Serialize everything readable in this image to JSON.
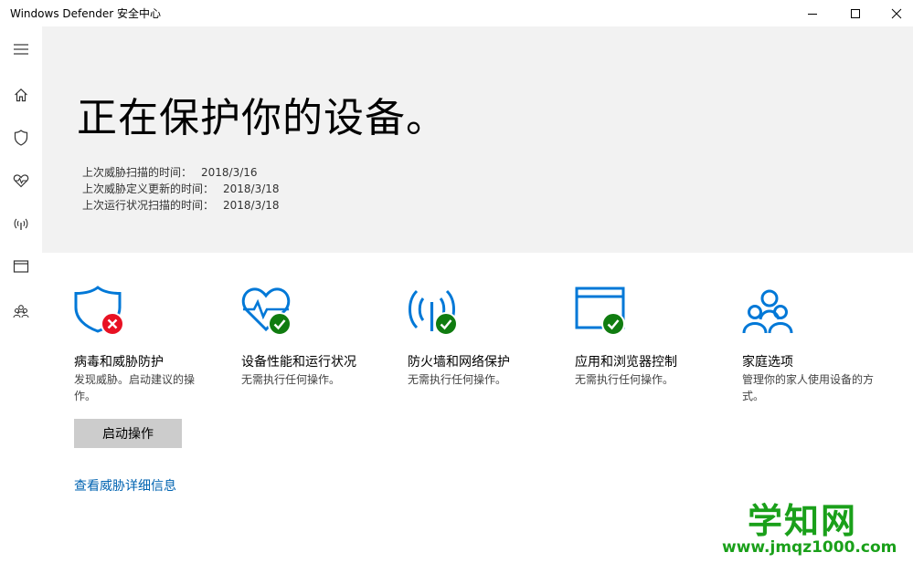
{
  "window": {
    "title": "Windows Defender 安全中心"
  },
  "sidebar": {
    "items": [
      {
        "icon": "hamburger-menu-icon"
      },
      {
        "icon": "home-icon"
      },
      {
        "icon": "shield-icon"
      },
      {
        "icon": "heart-pulse-icon"
      },
      {
        "icon": "wireless-icon"
      },
      {
        "icon": "browser-window-icon"
      },
      {
        "icon": "family-icon"
      }
    ]
  },
  "hero": {
    "title": "正在保护你的设备。",
    "scans": [
      {
        "label": "上次威胁扫描的时间：",
        "value": "2018/3/16"
      },
      {
        "label": "上次威胁定义更新的时间：",
        "value": "2018/3/18"
      },
      {
        "label": "上次运行状况扫描的时间：",
        "value": "2018/3/18"
      }
    ]
  },
  "cards": [
    {
      "title": "病毒和威胁防护",
      "status": "发现威胁。启动建议的操作。",
      "icon": "shield-icon",
      "badge": "error"
    },
    {
      "title": "设备性能和运行状况",
      "status": "无需执行任何操作。",
      "icon": "heart-pulse-icon",
      "badge": "ok"
    },
    {
      "title": "防火墙和网络保护",
      "status": "无需执行任何操作。",
      "icon": "wireless-icon",
      "badge": "ok"
    },
    {
      "title": "应用和浏览器控制",
      "status": "无需执行任何操作。",
      "icon": "browser-window-icon",
      "badge": "ok"
    },
    {
      "title": "家庭选项",
      "status": "管理你的家人使用设备的方式。",
      "icon": "family-icon",
      "badge": "none"
    }
  ],
  "actions": {
    "start_label": "启动操作",
    "details_link": "查看威胁详细信息"
  },
  "watermark": {
    "brand": "学知网",
    "url": "www.jmqz1000.com"
  },
  "colors": {
    "accent": "#0063b1",
    "icon_blue": "#0078d7",
    "ok_green": "#107c10",
    "error_red": "#e81123",
    "hero_bg": "#f2f2f2",
    "button_bg": "#cccccc"
  }
}
